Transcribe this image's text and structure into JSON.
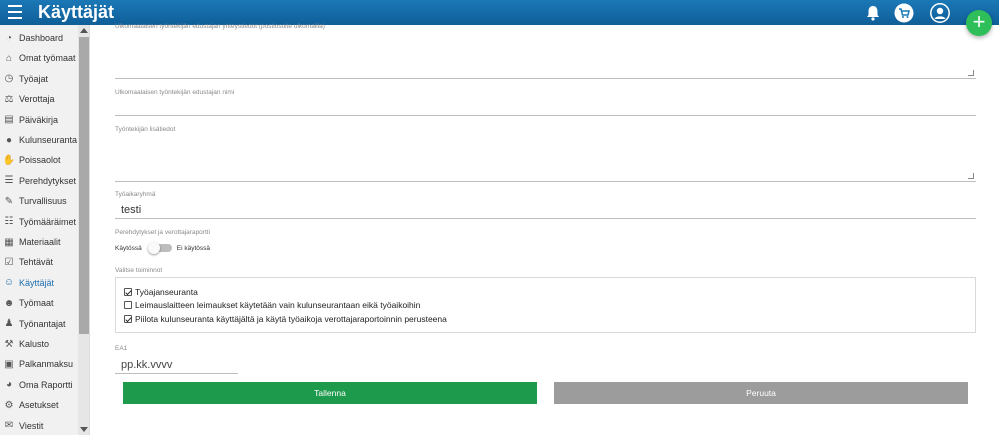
{
  "header": {
    "title": "Käyttäjät",
    "icons": [
      "menu-icon",
      "bell-icon",
      "cart-icon",
      "user-icon"
    ],
    "fab_symbol": "+"
  },
  "sidebar": {
    "items": [
      {
        "label": "Dashboard",
        "icon": "dashboard-icon",
        "glyph": "◔"
      },
      {
        "label": "Omat työmaat",
        "icon": "site-icon",
        "glyph": "⌂"
      },
      {
        "label": "Työajat",
        "icon": "stopwatch-icon",
        "glyph": "◷"
      },
      {
        "label": "Verottaja",
        "icon": "gavel-icon",
        "glyph": "⚖"
      },
      {
        "label": "Päiväkirja",
        "icon": "book-icon",
        "glyph": "▤"
      },
      {
        "label": "Kulunseuranta",
        "icon": "location-icon",
        "glyph": "●"
      },
      {
        "label": "Poissaolot",
        "icon": "thumb-down-icon",
        "glyph": "✋"
      },
      {
        "label": "Perehdytykset",
        "icon": "checklist-icon",
        "glyph": "☰"
      },
      {
        "label": "Turvallisuus",
        "icon": "wrench-icon",
        "glyph": "✎"
      },
      {
        "label": "Työmääräimet",
        "icon": "list-icon",
        "glyph": "☷"
      },
      {
        "label": "Materiaalit",
        "icon": "materials-icon",
        "glyph": "▦"
      },
      {
        "label": "Tehtävät",
        "icon": "tasks-icon",
        "glyph": "☑"
      },
      {
        "label": "Käyttäjät",
        "icon": "users-icon",
        "glyph": "☺",
        "active": true
      },
      {
        "label": "Työmaat",
        "icon": "worker-icon",
        "glyph": "☻"
      },
      {
        "label": "Työnantajat",
        "icon": "employer-icon",
        "glyph": "♟"
      },
      {
        "label": "Kalusto",
        "icon": "hammer-icon",
        "glyph": "⚒"
      },
      {
        "label": "Palkanmaksu",
        "icon": "payment-icon",
        "glyph": "▣"
      },
      {
        "label": "Oma Raportti",
        "icon": "pie-chart-icon",
        "glyph": "◕"
      },
      {
        "label": "Asetukset",
        "icon": "gear-icon",
        "glyph": "⚙"
      },
      {
        "label": "Viestit",
        "icon": "mail-icon",
        "glyph": "✉"
      }
    ]
  },
  "form": {
    "field_top_label": "Ulkomaalaisen työntekijän edustajan yhteystiedot (postiosoite ulkomailla)",
    "rep_name_label": "Ulkomaalaisen työntekijän edustajan nimi",
    "extra_info_label": "Työntekijän lisätiedot",
    "work_group_label": "Työaikaryhmä",
    "work_group_value": "testi",
    "induction_label": "Perehdytykset ja verottajaraportti",
    "toggle_on_label": "Käytössä",
    "toggle_off_label": "Ei käytössä",
    "functions_label": "Valitse toiminnot",
    "options": [
      {
        "label": "Työajanseuranta",
        "checked": true
      },
      {
        "label": "Leimauslaitteen leimaukset käytetään vain kulunseurantaan eikä työaikoihin",
        "checked": false
      },
      {
        "label": "Piilota kulunseuranta käyttäjältä ja käytä työaikoja verottajaraportoinnin perusteena",
        "checked": true
      }
    ],
    "ea1_label": "EA1",
    "ea1_placeholder": "pp.kk.vvvv",
    "save_label": "Tallenna",
    "cancel_label": "Peruuta"
  },
  "colors": {
    "header": "#1b78b6",
    "save": "#1e9a4c",
    "cancel": "#9c9c9c",
    "fab": "#2fbf5a",
    "active": "#1f6fb0"
  }
}
